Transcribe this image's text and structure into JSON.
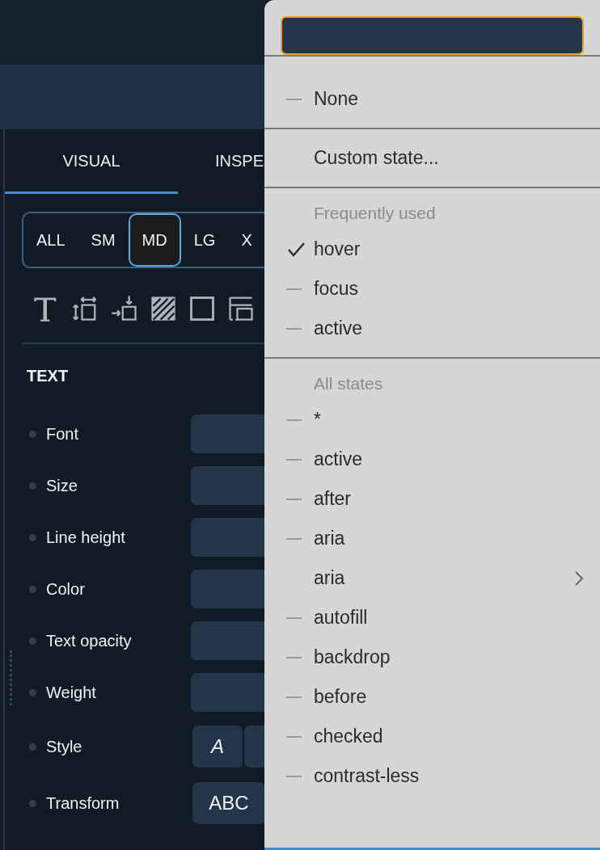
{
  "panel": {
    "tabs": [
      {
        "label": "VISUAL",
        "selected": true
      },
      {
        "label": "INSPE",
        "selected": false
      }
    ],
    "breakpoints": [
      {
        "label": "ALL",
        "selected": false
      },
      {
        "label": "SM",
        "selected": false
      },
      {
        "label": "MD",
        "selected": true
      },
      {
        "label": "LG",
        "selected": false
      },
      {
        "label": "X",
        "selected": false
      }
    ],
    "tools": [
      {
        "kind": "text"
      },
      {
        "kind": "spacing"
      },
      {
        "kind": "position"
      },
      {
        "kind": "background"
      },
      {
        "kind": "border"
      },
      {
        "kind": "layout"
      }
    ],
    "section": "TEXT",
    "properties": [
      {
        "label": "Font",
        "kind": "field"
      },
      {
        "label": "Size",
        "kind": "field"
      },
      {
        "label": "Line height",
        "kind": "field"
      },
      {
        "label": "Color",
        "kind": "field"
      },
      {
        "label": "Text opacity",
        "kind": "field"
      },
      {
        "label": "Weight",
        "kind": "field"
      },
      {
        "label": "Style",
        "kind": "buttons",
        "buttons": [
          {
            "kind": "label",
            "label": "A"
          },
          {
            "kind": "blank"
          }
        ]
      },
      {
        "label": "Transform",
        "kind": "buttons",
        "buttons": [
          {
            "kind": "label",
            "label": "ABC"
          }
        ]
      }
    ]
  },
  "menu": {
    "search": {
      "focused": true
    },
    "sections": [
      {
        "items": [
          {
            "label": "None",
            "kind": "state",
            "checked": false
          }
        ]
      },
      {
        "items": [
          {
            "label": "Custom state...",
            "kind": "action"
          }
        ]
      },
      {
        "heading": "Frequently used",
        "items": [
          {
            "label": "hover",
            "kind": "state",
            "checked": true
          },
          {
            "label": "focus",
            "kind": "state",
            "checked": false
          },
          {
            "label": "active",
            "kind": "state",
            "checked": false
          }
        ]
      },
      {
        "heading": "All states",
        "items": [
          {
            "label": "*",
            "kind": "state",
            "checked": false
          },
          {
            "label": "active",
            "kind": "state",
            "checked": false
          },
          {
            "label": "after",
            "kind": "state",
            "checked": false
          },
          {
            "label": "aria",
            "kind": "state",
            "checked": false
          },
          {
            "label": "aria",
            "kind": "submenu"
          },
          {
            "label": "autofill",
            "kind": "state",
            "checked": false
          },
          {
            "label": "backdrop",
            "kind": "state",
            "checked": false
          },
          {
            "label": "before",
            "kind": "state",
            "checked": false
          },
          {
            "label": "checked",
            "kind": "state",
            "checked": false
          },
          {
            "label": "contrast-less",
            "kind": "state",
            "checked": false
          }
        ]
      }
    ]
  }
}
